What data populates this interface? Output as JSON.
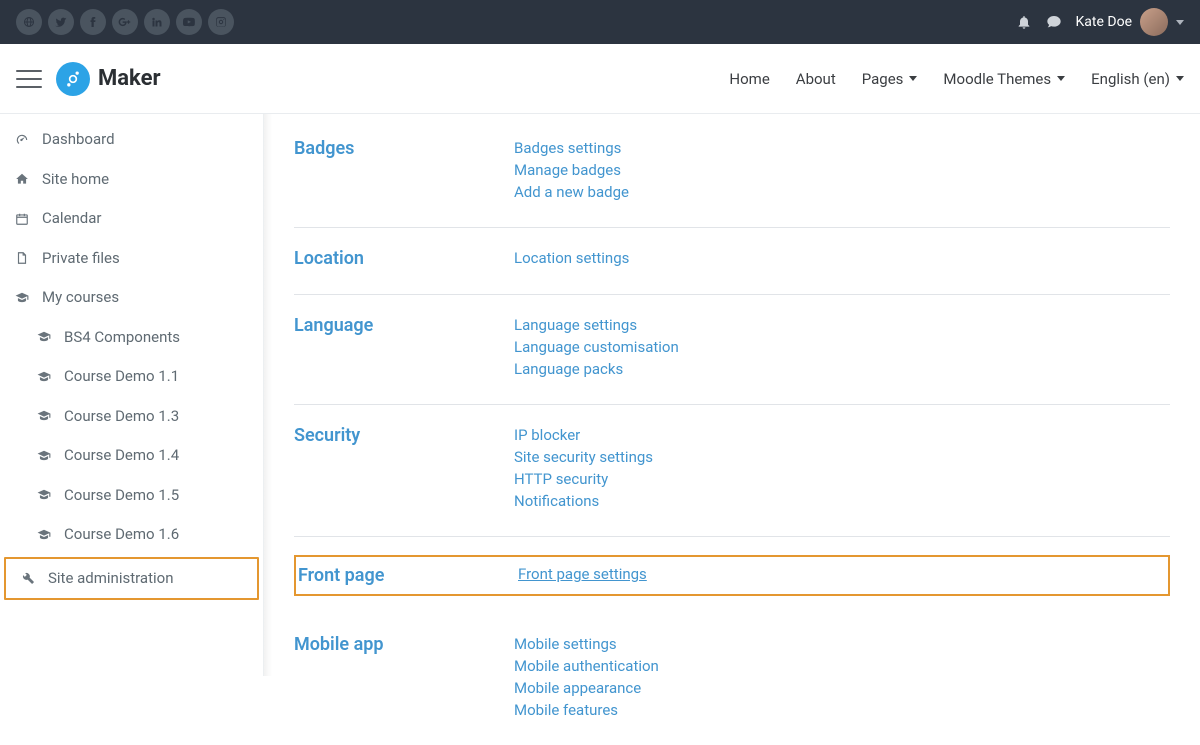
{
  "topbar": {
    "social": [
      "globe",
      "twitter",
      "facebook",
      "google-plus",
      "linkedin",
      "youtube",
      "instagram"
    ],
    "user_name": "Kate Doe"
  },
  "brand": {
    "name": "Maker"
  },
  "nav": {
    "home": "Home",
    "about": "About",
    "pages": "Pages",
    "themes": "Moodle Themes",
    "lang": "English (en)"
  },
  "sidebar": {
    "dashboard": "Dashboard",
    "sitehome": "Site home",
    "calendar": "Calendar",
    "privatefiles": "Private files",
    "mycourses": "My courses",
    "courses": [
      "BS4 Components",
      "Course Demo 1.1",
      "Course Demo 1.3",
      "Course Demo 1.4",
      "Course Demo 1.5",
      "Course Demo 1.6"
    ],
    "siteadmin": "Site administration"
  },
  "categories": [
    {
      "name": "Badges",
      "items": [
        "Badges settings",
        "Manage badges",
        "Add a new badge"
      ]
    },
    {
      "name": "Location",
      "items": [
        "Location settings"
      ]
    },
    {
      "name": "Language",
      "items": [
        "Language settings",
        "Language customisation",
        "Language packs"
      ]
    },
    {
      "name": "Security",
      "items": [
        "IP blocker",
        "Site security settings",
        "HTTP security",
        "Notifications"
      ]
    },
    {
      "name": "Front page",
      "items": [
        "Front page settings"
      ],
      "highlight": true
    },
    {
      "name": "Mobile app",
      "items": [
        "Mobile settings",
        "Mobile authentication",
        "Mobile appearance",
        "Mobile features"
      ]
    }
  ]
}
